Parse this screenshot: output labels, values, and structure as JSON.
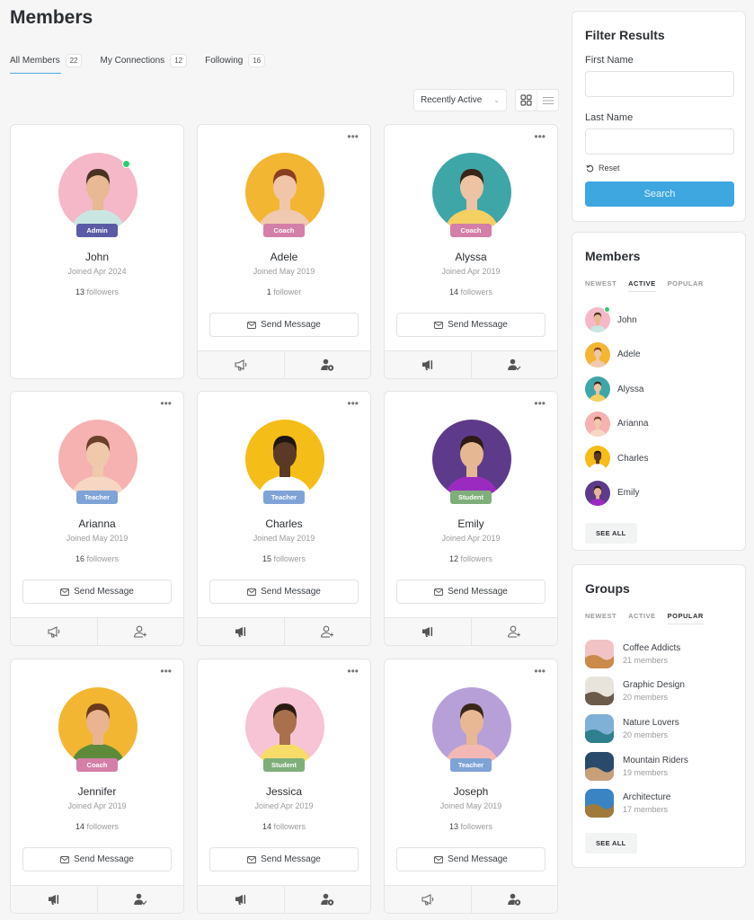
{
  "page": {
    "title": "Members"
  },
  "tabs": [
    {
      "label": "All Members",
      "count": "22",
      "active": true
    },
    {
      "label": "My Connections",
      "count": "12",
      "active": false
    },
    {
      "label": "Following",
      "count": "16",
      "active": false
    }
  ],
  "toolbar": {
    "sort_value": "Recently Active",
    "grid_view_icon": "grid-icon",
    "list_view_icon": "list-icon"
  },
  "members": [
    {
      "name": "John",
      "role": "Admin",
      "role_color": "#5b5aa5",
      "joined": "Joined Apr 2024",
      "followers_count": "13",
      "followers_label": "followers",
      "online": true,
      "self": true,
      "bg": "#f4b8c8",
      "shirt": "#c9e6e3",
      "skin": "#e9b894",
      "hair": "#4a3223"
    },
    {
      "name": "Adele",
      "role": "Coach",
      "role_color": "#d37fa8",
      "joined": "Joined May 2019",
      "followers_count": "1",
      "followers_label": "follower",
      "online": false,
      "follow_icon": "megaphone-outline-icon",
      "connect_icon": "user-pending-icon",
      "bg": "#f2b632",
      "shirt": "#f0c9b0",
      "skin": "#f1c6a8",
      "hair": "#8a3e22"
    },
    {
      "name": "Alyssa",
      "role": "Coach",
      "role_color": "#d37fa8",
      "joined": "Joined Apr 2019",
      "followers_count": "14",
      "followers_label": "followers",
      "online": false,
      "follow_icon": "megaphone-filled-icon",
      "connect_icon": "user-check-icon",
      "bg": "#3fa6a8",
      "shirt": "#f4d063",
      "skin": "#eec3a4",
      "hair": "#3a2418"
    },
    {
      "name": "Arianna",
      "role": "Teacher",
      "role_color": "#7fa3d6",
      "joined": "Joined May 2019",
      "followers_count": "16",
      "followers_label": "followers",
      "online": false,
      "follow_icon": "megaphone-outline-icon",
      "connect_icon": "user-add-icon",
      "bg": "#f6b1b1",
      "shirt": "#f7d6c4",
      "skin": "#f0c8ac",
      "hair": "#6b4028"
    },
    {
      "name": "Charles",
      "role": "Teacher",
      "role_color": "#7fa3d6",
      "joined": "Joined May 2019",
      "followers_count": "15",
      "followers_label": "followers",
      "online": false,
      "follow_icon": "megaphone-filled-icon",
      "connect_icon": "user-add-icon",
      "bg": "#f5bd17",
      "shirt": "#ffffff",
      "skin": "#5a3a26",
      "hair": "#1f1612"
    },
    {
      "name": "Emily",
      "role": "Student",
      "role_color": "#7fae7a",
      "joined": "Joined Apr 2019",
      "followers_count": "12",
      "followers_label": "followers",
      "online": false,
      "follow_icon": "megaphone-filled-icon",
      "connect_icon": "user-add-icon",
      "bg": "#5e3b8a",
      "shirt": "#9b2bc0",
      "skin": "#e6b793",
      "hair": "#2d1b14"
    },
    {
      "name": "Jennifer",
      "role": "Coach",
      "role_color": "#d37fa8",
      "joined": "Joined Apr 2019",
      "followers_count": "14",
      "followers_label": "followers",
      "online": false,
      "follow_icon": "megaphone-filled-icon",
      "connect_icon": "user-check-icon",
      "bg": "#f2b632",
      "shirt": "#5d8a3a",
      "skin": "#e9b48f",
      "hair": "#6b3a1c"
    },
    {
      "name": "Jessica",
      "role": "Student",
      "role_color": "#7fae7a",
      "joined": "Joined Apr 2019",
      "followers_count": "14",
      "followers_label": "followers",
      "online": false,
      "follow_icon": "megaphone-filled-icon",
      "connect_icon": "user-pending-icon",
      "bg": "#f6c4d4",
      "shirt": "#f7dc6a",
      "skin": "#a8704c",
      "hair": "#2a1a12"
    },
    {
      "name": "Joseph",
      "role": "Teacher",
      "role_color": "#7fa3d6",
      "joined": "Joined May 2019",
      "followers_count": "13",
      "followers_label": "followers",
      "online": false,
      "follow_icon": "megaphone-outline-icon",
      "connect_icon": "user-pending-icon",
      "bg": "#b7a0d8",
      "shirt": "#f3b8b5",
      "skin": "#e8b894",
      "hair": "#3a2519"
    }
  ],
  "send_message_label": "Send Message",
  "filter": {
    "title": "Filter Results",
    "first_name_label": "First Name",
    "first_name_value": "",
    "last_name_label": "Last Name",
    "last_name_value": "",
    "reset_label": "Reset",
    "search_label": "Search"
  },
  "members_widget": {
    "title": "Members",
    "tabs": [
      {
        "label": "NEWEST",
        "active": false
      },
      {
        "label": "ACTIVE",
        "active": true
      },
      {
        "label": "POPULAR",
        "active": false
      }
    ],
    "items": [
      {
        "name": "John",
        "online": true
      },
      {
        "name": "Adele",
        "online": false
      },
      {
        "name": "Alyssa",
        "online": false
      },
      {
        "name": "Arianna",
        "online": false
      },
      {
        "name": "Charles",
        "online": false
      },
      {
        "name": "Emily",
        "online": false
      }
    ],
    "see_all_label": "SEE ALL"
  },
  "groups_widget": {
    "title": "Groups",
    "tabs": [
      {
        "label": "NEWEST",
        "active": false
      },
      {
        "label": "ACTIVE",
        "active": false
      },
      {
        "label": "POPULAR",
        "active": true
      }
    ],
    "items": [
      {
        "name": "Coffee Addicts",
        "members": "21 members",
        "c1": "#f2c3c5",
        "c2": "#c98a4a"
      },
      {
        "name": "Graphic Design",
        "members": "20 members",
        "c1": "#e8e4dc",
        "c2": "#6b5a4a"
      },
      {
        "name": "Nature Lovers",
        "members": "20 members",
        "c1": "#7fb0d6",
        "c2": "#2f7f8f"
      },
      {
        "name": "Mountain Riders",
        "members": "19 members",
        "c1": "#2a4a6b",
        "c2": "#c7a07a"
      },
      {
        "name": "Architecture",
        "members": "17 members",
        "c1": "#3b84c4",
        "c2": "#a07a3a"
      }
    ],
    "see_all_label": "SEE ALL"
  }
}
